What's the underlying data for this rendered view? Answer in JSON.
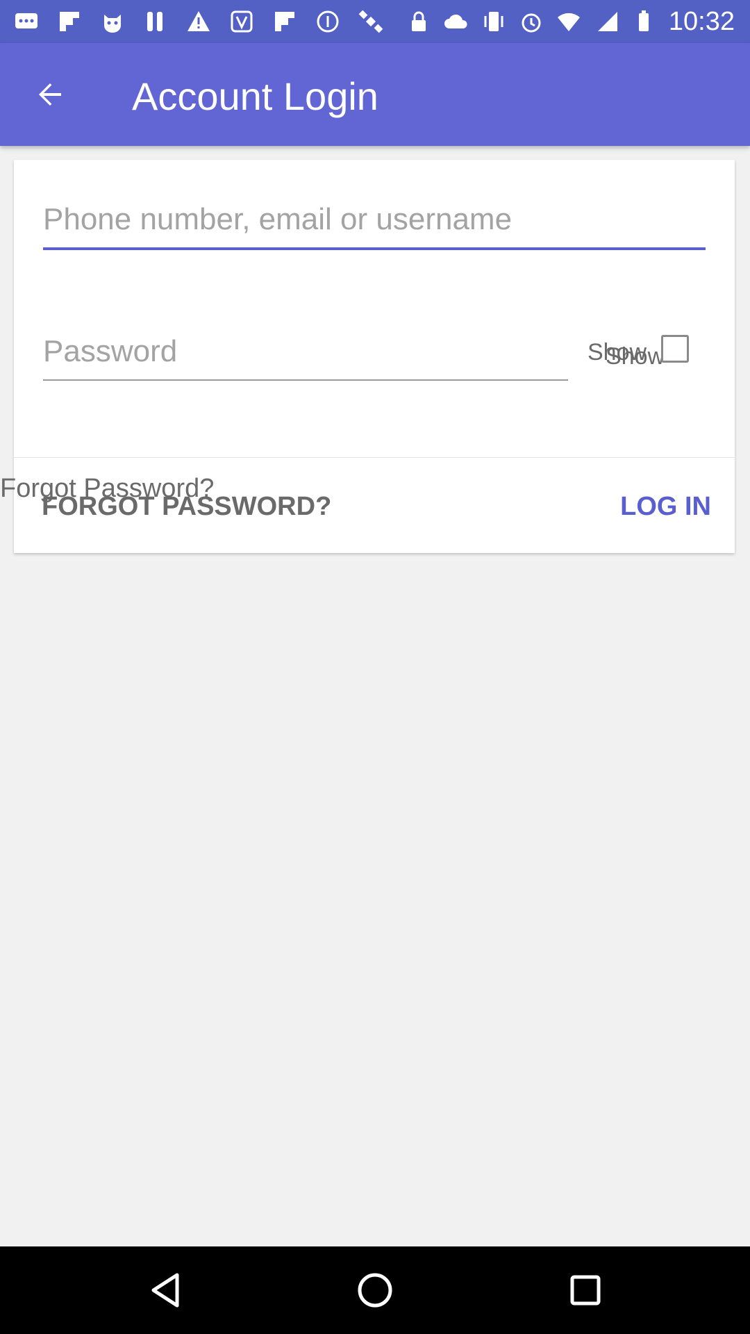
{
  "status_bar": {
    "time": "10:32",
    "left_icons": [
      "chat-dots-icon",
      "flipboard-icon",
      "cat-app-icon",
      "tools-icon",
      "warning-icon",
      "vine-app-icon",
      "flipboard-icon",
      "circle-info-icon",
      "satellite-icon"
    ],
    "right_icons": [
      "lock-icon",
      "cloud-icon",
      "vibrate-icon",
      "alarm-icon",
      "wifi-icon",
      "signal-icon",
      "battery-icon"
    ]
  },
  "app_bar": {
    "title": "Account Login",
    "back_icon": "arrow-left-icon"
  },
  "form": {
    "username_placeholder": "Phone number, email or username",
    "username_value": "",
    "password_placeholder": "Password",
    "password_value": "",
    "show_label_a": "Show",
    "show_label_b": "Show",
    "show_checked": false,
    "forgot_overlap_text": "Forgot Password?",
    "forgot_button": "FORGOT PASSWORD?",
    "login_button": "LOG IN",
    "accent_color": "#5a5fcf"
  },
  "colors": {
    "app_bar": "#6166d4",
    "status_bar": "#5360c4",
    "background": "#f1f1f1"
  },
  "nav_bar": {
    "buttons": [
      "back-triangle-icon",
      "home-circle-icon",
      "recents-square-icon"
    ]
  }
}
